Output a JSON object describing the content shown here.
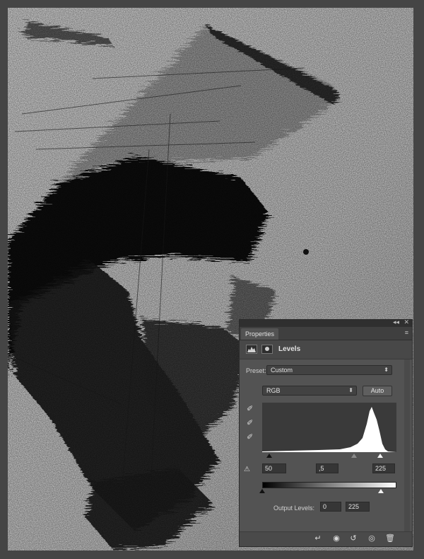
{
  "panel": {
    "tab_title": "Properties",
    "collapse_glyph": "◂◂",
    "close_glyph": "✕",
    "menu_glyph": "≡",
    "adjustment_title": "Levels",
    "preset_label": "Preset:",
    "preset_value": "Custom",
    "channel_value": "RGB",
    "auto_label": "Auto",
    "input_black": "50",
    "input_gamma": ",5",
    "input_white": "225",
    "output_label": "Output Levels:",
    "output_black": "0",
    "output_white": "225",
    "input_black_level": 50,
    "input_gamma_level": 0.5,
    "input_white_level": 225,
    "output_black_level": 0,
    "output_white_level": 225
  },
  "icons": {
    "black_point": "eyedropper-black-icon",
    "gray_point": "eyedropper-gray-icon",
    "white_point": "eyedropper-white-icon",
    "clipping": "clipping-warning-icon",
    "clip_to_layer": "clip-to-layer-icon",
    "view_previous": "view-previous-state-icon",
    "reset": "reset-icon",
    "visibility": "eye-icon",
    "delete": "trash-icon"
  },
  "colors": {
    "panel_bg": "#535353",
    "canvas_bg": "#c9c9c9"
  }
}
